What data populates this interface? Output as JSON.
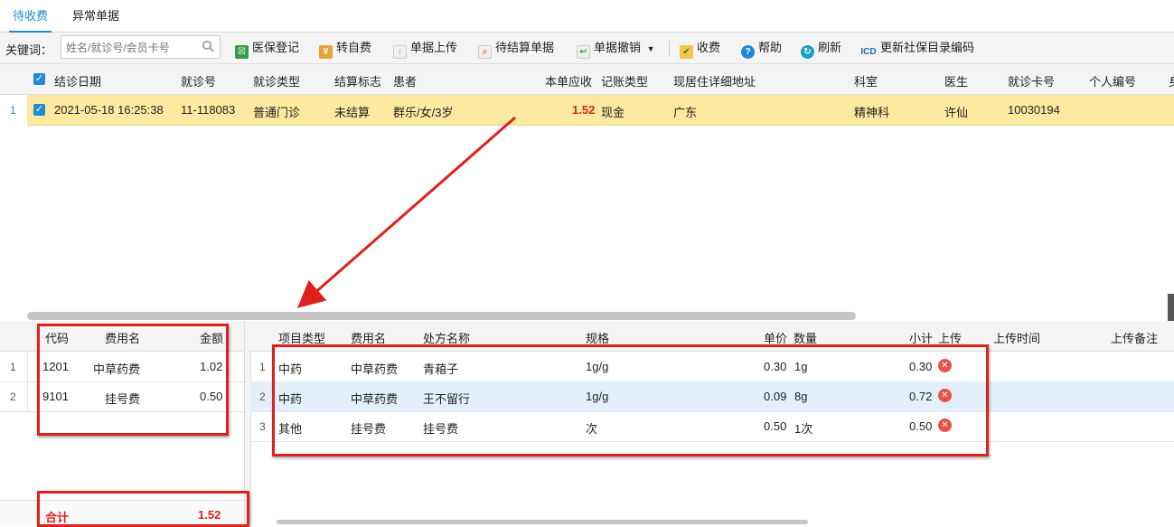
{
  "tabs": [
    {
      "label": "待收费",
      "active": true
    },
    {
      "label": "异常单据",
      "active": false
    }
  ],
  "toolbar": {
    "keyword_label": "关键词：",
    "search_placeholder": "姓名/就诊号/会员卡号",
    "buttons": [
      {
        "label": "医保登记",
        "icon": "medical-insurance-icon"
      },
      {
        "label": "转自费",
        "icon": "self-pay-icon"
      },
      {
        "label": "单据上传",
        "icon": "upload-icon"
      },
      {
        "label": "待结算单据",
        "icon": "pending-doc-icon"
      },
      {
        "label": "单据撤销",
        "icon": "revoke-icon"
      },
      {
        "label": "收费",
        "icon": "charge-icon"
      },
      {
        "label": "帮助",
        "icon": "help-icon"
      },
      {
        "label": "刷新",
        "icon": "refresh-icon"
      },
      {
        "label": "更新社保目录编码",
        "icon": "icd-icon"
      }
    ]
  },
  "main_grid": {
    "columns": [
      "结诊日期",
      "就诊号",
      "就诊类型",
      "结算标志",
      "患者",
      "本单应收",
      "记账类型",
      "现居住详细地址",
      "科室",
      "医生",
      "就诊卡号",
      "个人编号",
      "身"
    ],
    "rows": [
      {
        "row_num": "1",
        "date": "2021-05-18 16:25:38",
        "visit_no": "11-118083",
        "visit_type": "普通门诊",
        "settle_flag": "未结算",
        "patient": "群乐/女/3岁",
        "amount": "1.52",
        "account_type": "现金",
        "address": "广东",
        "dept": "精神科",
        "doctor": "许仙",
        "card_no": "10030194",
        "personal_no": ""
      }
    ]
  },
  "fee_grid": {
    "columns": [
      "代码",
      "费用名",
      "金额"
    ],
    "rows": [
      {
        "row_num": "1",
        "code": "1201",
        "name": "中草药费",
        "amount": "1.02"
      },
      {
        "row_num": "2",
        "code": "9101",
        "name": "挂号费",
        "amount": "0.50"
      }
    ],
    "total_label": "合计",
    "total_value": "1.52"
  },
  "detail_grid": {
    "columns": [
      "项目类型",
      "费用名",
      "处方名称",
      "规格",
      "单价",
      "数量",
      "小计",
      "上传",
      "上传时间",
      "上传备注"
    ],
    "rows": [
      {
        "row_num": "1",
        "item_type": "中药",
        "fee_name": "中草药费",
        "rx_name": "青葙子",
        "spec": "1g/g",
        "price": "0.30",
        "qty": "1g",
        "subtotal": "0.30"
      },
      {
        "row_num": "2",
        "item_type": "中药",
        "fee_name": "中草药费",
        "rx_name": "王不留行",
        "spec": "1g/g",
        "price": "0.09",
        "qty": "8g",
        "subtotal": "0.72"
      },
      {
        "row_num": "3",
        "item_type": "其他",
        "fee_name": "挂号费",
        "rx_name": "挂号费",
        "spec": "次",
        "price": "0.50",
        "qty": "1次",
        "subtotal": "0.50"
      }
    ]
  },
  "colors": {
    "accent": "#1f8ad6",
    "selected_row": "#fde9a0",
    "highlight_row": "#e3f0fb",
    "amount_red": "#e0201b",
    "annotation_red": "#e0201b"
  }
}
